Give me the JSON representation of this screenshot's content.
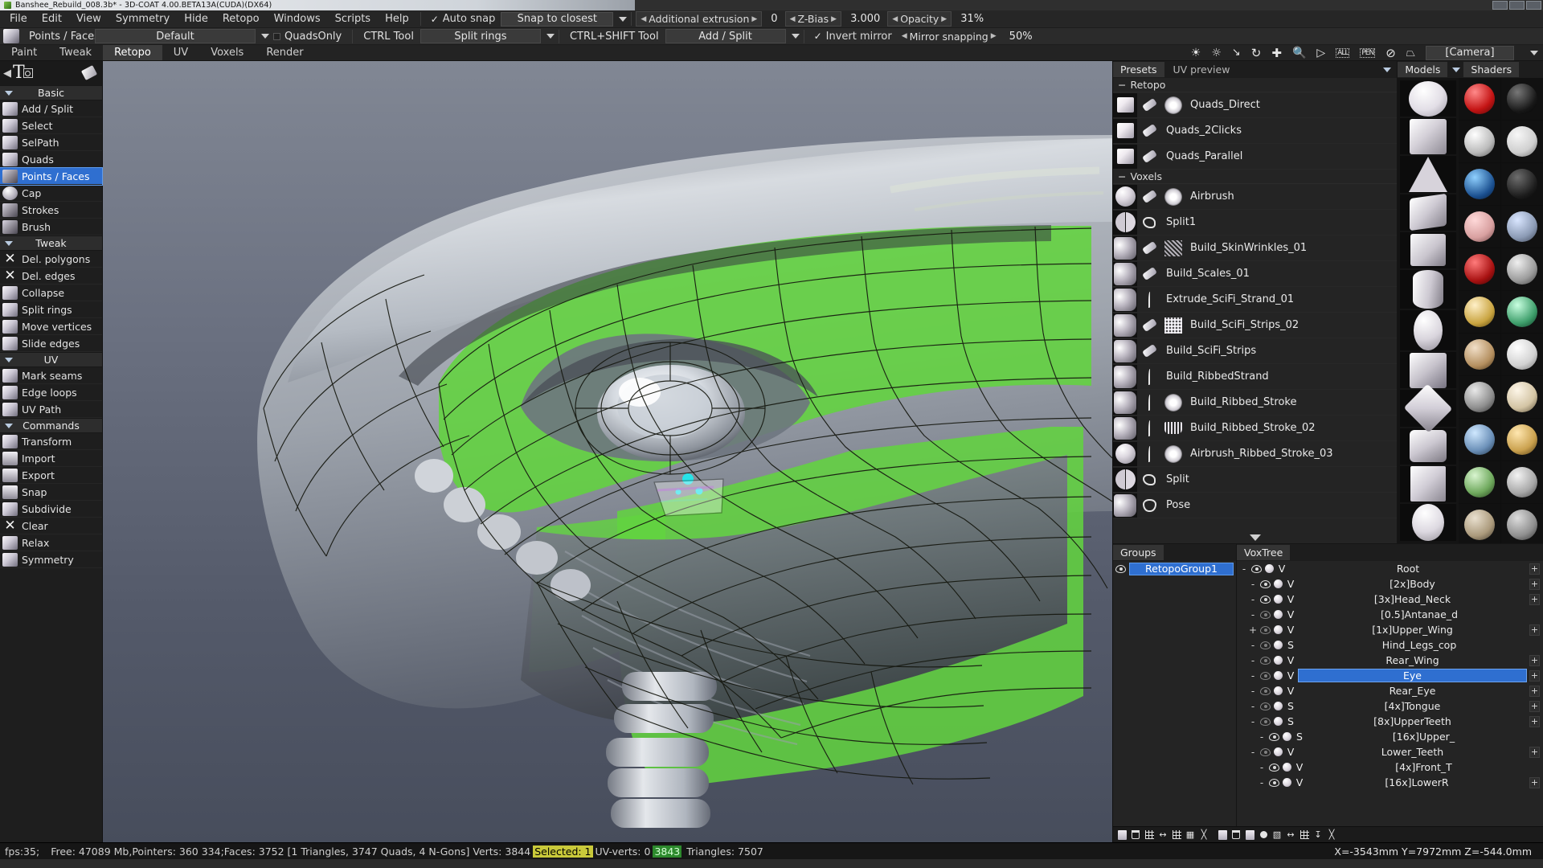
{
  "window": {
    "title": "Banshee_Rebuild_008.3b* - 3D-COAT 4.00.BETA13A(CUDA)(DX64)",
    "app_icon": "3dcoat-logo-icon"
  },
  "menubar": {
    "items": [
      "File",
      "Edit",
      "View",
      "Symmetry",
      "Hide",
      "Retopo",
      "Windows",
      "Scripts",
      "Help"
    ],
    "auto_snap": {
      "label": "Auto snap",
      "checked": true
    },
    "snap_mode": "Snap to closest",
    "additional_extrusion": {
      "label": "Additional extrusion",
      "value": "0"
    },
    "z_bias": {
      "label": "Z-Bias",
      "value": "3.000"
    },
    "opacity": {
      "label": "Opacity",
      "value": "31%"
    }
  },
  "toolbar": {
    "tool_name": "Points / Faces",
    "preset_select": "Default",
    "quads_only": "QuadsOnly",
    "ctrl_tool_label": "CTRL Tool",
    "ctrl_tool_value": "Split rings",
    "ctrl_shift_tool_label": "CTRL+SHIFT Tool",
    "ctrl_shift_tool_value": "Add / Split",
    "invert_mirror": {
      "label": "Invert mirror",
      "checked": true
    },
    "mirror_snapping": {
      "label": "Mirror snapping",
      "value": "50%"
    },
    "camera_select": "[Camera]",
    "view_icons": [
      "light-icon",
      "bulb-icon",
      "light-move-icon",
      "rotate-icon",
      "move-icon",
      "zoom-icon",
      "play-icon",
      "all-frame-icon",
      "pen-frame-icon",
      "no-symmetry-icon",
      "cube-view-icon"
    ]
  },
  "room_tabs": {
    "items": [
      "Paint",
      "Tweak",
      "Retopo",
      "UV",
      "Voxels",
      "Render"
    ],
    "active": "Retopo"
  },
  "left_panel": {
    "header_glyph": "T",
    "groups": [
      {
        "name": "Basic",
        "items": [
          {
            "label": "Add / Split",
            "icon": "cube-icon",
            "selected": false
          },
          {
            "label": "Select",
            "icon": "cube-icon",
            "selected": false
          },
          {
            "label": "SelPath",
            "icon": "cube-icon",
            "selected": false
          },
          {
            "label": "Quads",
            "icon": "cube-icon",
            "selected": false
          },
          {
            "label": "Points / Faces",
            "icon": "points-faces-icon",
            "selected": true
          },
          {
            "label": "Cap",
            "icon": "sphere-icon",
            "selected": false
          },
          {
            "label": "Strokes",
            "icon": "strokes-icon",
            "selected": false
          },
          {
            "label": "Brush",
            "icon": "brush-icon",
            "selected": false
          }
        ]
      },
      {
        "name": "Tweak",
        "items": [
          {
            "label": "Del. polygons",
            "icon": "delete-polygons-icon",
            "selected": false
          },
          {
            "label": "Del. edges",
            "icon": "delete-edges-icon",
            "selected": false
          },
          {
            "label": "Collapse",
            "icon": "cube-icon",
            "selected": false
          },
          {
            "label": "Split rings",
            "icon": "cube-icon",
            "selected": false
          },
          {
            "label": "Move vertices",
            "icon": "cube-icon",
            "selected": false
          },
          {
            "label": "Slide edges",
            "icon": "cube-icon",
            "selected": false
          }
        ]
      },
      {
        "name": "UV",
        "items": [
          {
            "label": "Mark seams",
            "icon": "cube-icon",
            "selected": false
          },
          {
            "label": "Edge loops",
            "icon": "cube-icon",
            "selected": false
          },
          {
            "label": "UV Path",
            "icon": "cube-icon",
            "selected": false
          }
        ]
      },
      {
        "name": "Commands",
        "items": [
          {
            "label": "Transform",
            "icon": "cube-icon",
            "selected": false
          },
          {
            "label": "Import",
            "icon": "import-icon",
            "selected": false
          },
          {
            "label": "Export",
            "icon": "export-icon",
            "selected": false
          },
          {
            "label": "Snap",
            "icon": "snap-icon",
            "selected": false
          },
          {
            "label": "Subdivide",
            "icon": "cube-icon",
            "selected": false
          },
          {
            "label": "Clear",
            "icon": "clear-x-icon",
            "selected": false
          },
          {
            "label": "Relax",
            "icon": "cube-icon",
            "selected": false
          },
          {
            "label": "Symmetry",
            "icon": "symmetry-icon",
            "selected": false
          }
        ]
      }
    ]
  },
  "presets_panel": {
    "tabs": [
      {
        "label": "Presets",
        "active": true
      },
      {
        "label": "UV preview",
        "active": false
      }
    ],
    "sections": [
      {
        "name": "Retopo",
        "items": [
          {
            "label": "Quads_Direct",
            "thumb": "cube-thumb",
            "brush": "stroke-icon",
            "alpha": "round-alpha-icon"
          },
          {
            "label": "Quads_2Clicks",
            "thumb": "cube-thumb",
            "brush": "stroke-icon",
            "alpha": ""
          },
          {
            "label": "Quads_Parallel",
            "thumb": "cube-thumb",
            "brush": "stroke-icon",
            "alpha": ""
          }
        ]
      },
      {
        "name": "Voxels",
        "items": [
          {
            "label": "Airbrush",
            "thumb": "sphere-thumb",
            "brush": "stroke-icon",
            "alpha": "round-alpha-icon"
          },
          {
            "label": "Split1",
            "thumb": "split-sphere-thumb",
            "brush": "hand-icon",
            "alpha": ""
          },
          {
            "label": "Build_SkinWrinkles_01",
            "thumb": "knuckles-thumb",
            "brush": "stroke-icon",
            "alpha": "hatch-alpha-icon"
          },
          {
            "label": "Build_Scales_01",
            "thumb": "knuckles-thumb",
            "brush": "stroke-icon",
            "alpha": ""
          },
          {
            "label": "Extrude_SciFi_Strand_01",
            "thumb": "knuckles-thumb",
            "brush": "curve-stroke-icon",
            "alpha": ""
          },
          {
            "label": "Build_SciFi_Strips_02",
            "thumb": "knuckles-thumb",
            "brush": "stroke-icon",
            "alpha": "grid-alpha-icon"
          },
          {
            "label": "Build_SciFi_Strips",
            "thumb": "knuckles-thumb",
            "brush": "stroke-icon",
            "alpha": ""
          },
          {
            "label": "Build_RibbedStrand",
            "thumb": "knuckles-thumb",
            "brush": "curve-stroke-icon",
            "alpha": ""
          },
          {
            "label": "Build_Ribbed_Stroke",
            "thumb": "knuckles-thumb",
            "brush": "curve-stroke-icon",
            "alpha": "round-alpha-icon"
          },
          {
            "label": "Build_Ribbed_Stroke_02",
            "thumb": "knuckles-thumb",
            "brush": "curve-stroke-icon",
            "alpha": "teeth-alpha-icon"
          },
          {
            "label": "Airbrush_Ribbed_Stroke_03",
            "thumb": "sphere-thumb",
            "brush": "curve-stroke-icon",
            "alpha": "round-alpha-icon"
          },
          {
            "label": "Split",
            "thumb": "split-sphere-thumb",
            "brush": "hand-icon",
            "alpha": ""
          },
          {
            "label": "Pose",
            "thumb": "bend-thumb",
            "brush": "star-icon",
            "alpha": ""
          }
        ]
      }
    ]
  },
  "models_panel": {
    "title": "Models"
  },
  "shaders_panel": {
    "title": "Shaders"
  },
  "groups_panel": {
    "title": "Groups",
    "items": [
      {
        "label": "RetopoGroup1",
        "selected": true,
        "visible": true
      }
    ]
  },
  "voxtree_panel": {
    "title": "VoxTree",
    "rows": [
      {
        "indent": 0,
        "expand": "-",
        "type": "V",
        "label": "Root",
        "selected": false,
        "plus": true,
        "dim": false
      },
      {
        "indent": 1,
        "expand": "-",
        "type": "V",
        "label": "[2x]Body",
        "selected": false,
        "plus": true,
        "dim": false
      },
      {
        "indent": 1,
        "expand": "-",
        "type": "V",
        "label": "[3x]Head_Neck",
        "selected": false,
        "plus": true,
        "dim": false
      },
      {
        "indent": 1,
        "expand": "-",
        "type": "V",
        "label": "[0.5]Antanae_d",
        "selected": false,
        "plus": false,
        "dim": true
      },
      {
        "indent": 1,
        "expand": "+",
        "type": "V",
        "label": "[1x]Upper_Wing",
        "selected": false,
        "plus": true,
        "dim": true
      },
      {
        "indent": 1,
        "expand": "-",
        "type": "S",
        "label": "Hind_Legs_cop",
        "selected": false,
        "plus": false,
        "dim": true
      },
      {
        "indent": 1,
        "expand": "-",
        "type": "V",
        "label": "Rear_Wing",
        "selected": false,
        "plus": true,
        "dim": true
      },
      {
        "indent": 1,
        "expand": "-",
        "type": "V",
        "label": "Eye",
        "selected": true,
        "plus": true,
        "dim": true
      },
      {
        "indent": 1,
        "expand": "-",
        "type": "V",
        "label": "Rear_Eye",
        "selected": false,
        "plus": true,
        "dim": true
      },
      {
        "indent": 1,
        "expand": "-",
        "type": "S",
        "label": "[4x]Tongue",
        "selected": false,
        "plus": true,
        "dim": true
      },
      {
        "indent": 1,
        "expand": "-",
        "type": "S",
        "label": "[8x]UpperTeeth",
        "selected": false,
        "plus": true,
        "dim": true
      },
      {
        "indent": 2,
        "expand": "-",
        "type": "S",
        "label": "[16x]Upper_",
        "selected": false,
        "plus": false,
        "dim": false
      },
      {
        "indent": 1,
        "expand": "-",
        "type": "V",
        "label": "Lower_Teeth",
        "selected": false,
        "plus": true,
        "dim": true
      },
      {
        "indent": 2,
        "expand": "-",
        "type": "V",
        "label": "[4x]Front_T",
        "selected": false,
        "plus": false,
        "dim": false
      },
      {
        "indent": 2,
        "expand": "-",
        "type": "V",
        "label": "[16x]LowerR",
        "selected": false,
        "plus": true,
        "dim": false
      }
    ],
    "toolbar_icons": [
      "new-layer-icon",
      "delete-layer-icon",
      "grid-icon",
      "merge-icon",
      "grid2-icon",
      "table-icon",
      "cut-icon",
      "new-volume-icon",
      "delete-volume-icon",
      "duplicate-icon",
      "sphere-icon",
      "stack-icon",
      "merge-down-icon",
      "grid3-icon",
      "import-icon",
      "cut2-icon"
    ]
  },
  "statusbar": {
    "fps": "fps:35;",
    "text_before": "Free: 47089 Mb,Pointers: 360 334;Faces: 3752 [1 Triangles, 3747 Quads, 4 N-Gons] Verts: 3844",
    "selected_label": "Selected: 1",
    "uv_verts": "UV-verts: 0",
    "uv_count": "3843",
    "triangles": "Triangles: 7507",
    "coords": "X=-3543mm  Y=7972mm  Z=-544.0mm"
  },
  "colors": {
    "accent_blue": "#2f6fd0",
    "panel_bg": "#242424",
    "retopo_green": "#62d43f",
    "highlight_yellow": "#c9c93a",
    "highlight_green": "#2d8a2d"
  }
}
